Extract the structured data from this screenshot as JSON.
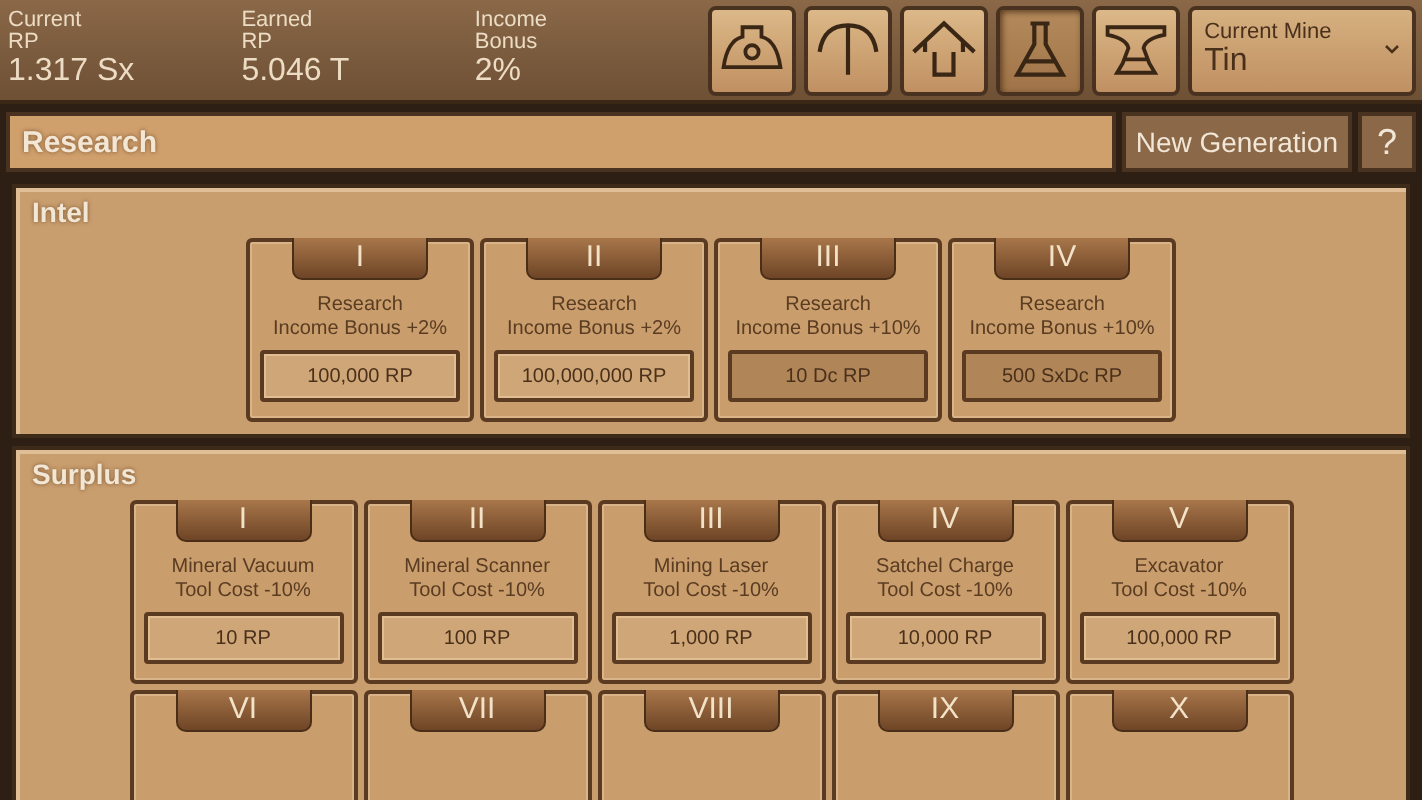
{
  "stats": [
    {
      "label": "Current\nRP",
      "value": "1.317 Sx"
    },
    {
      "label": "Earned\nRP",
      "value": "5.046 T"
    },
    {
      "label": "Income\nBonus",
      "value": "2%"
    }
  ],
  "nav_buttons": [
    {
      "kind": "helmet",
      "selected": false
    },
    {
      "kind": "pickaxe",
      "selected": false
    },
    {
      "kind": "upgrade",
      "selected": false
    },
    {
      "kind": "flask",
      "selected": true
    },
    {
      "kind": "anvil",
      "selected": false
    }
  ],
  "mine_select": {
    "label": "Current Mine",
    "value": "Tin"
  },
  "header": {
    "title": "Research",
    "new_generation_button": "New Generation",
    "help_button": "?"
  },
  "sections": [
    {
      "title": "Intel",
      "rows": [
        [
          {
            "numeral": "I",
            "name": "Research",
            "effect": "Income Bonus +2%",
            "cost": "100,000 RP",
            "disabled": false
          },
          {
            "numeral": "II",
            "name": "Research",
            "effect": "Income Bonus +2%",
            "cost": "100,000,000 RP",
            "disabled": false
          },
          {
            "numeral": "III",
            "name": "Research",
            "effect": "Income Bonus +10%",
            "cost": "10 Dc RP",
            "disabled": true
          },
          {
            "numeral": "IV",
            "name": "Research",
            "effect": "Income Bonus +10%",
            "cost": "500 SxDc RP",
            "disabled": true
          }
        ]
      ]
    },
    {
      "title": "Surplus",
      "rows": [
        [
          {
            "numeral": "I",
            "name": "Mineral Vacuum",
            "effect": "Tool Cost -10%",
            "cost": "10 RP",
            "disabled": false
          },
          {
            "numeral": "II",
            "name": "Mineral Scanner",
            "effect": "Tool Cost -10%",
            "cost": "100 RP",
            "disabled": false
          },
          {
            "numeral": "III",
            "name": "Mining Laser",
            "effect": "Tool Cost -10%",
            "cost": "1,000 RP",
            "disabled": false
          },
          {
            "numeral": "IV",
            "name": "Satchel Charge",
            "effect": "Tool Cost -10%",
            "cost": "10,000 RP",
            "disabled": false
          },
          {
            "numeral": "V",
            "name": "Excavator",
            "effect": "Tool Cost -10%",
            "cost": "100,000 RP",
            "disabled": false
          }
        ],
        [
          {
            "numeral": "VI"
          },
          {
            "numeral": "VII"
          },
          {
            "numeral": "VIII"
          },
          {
            "numeral": "IX"
          },
          {
            "numeral": "X"
          }
        ]
      ]
    }
  ]
}
